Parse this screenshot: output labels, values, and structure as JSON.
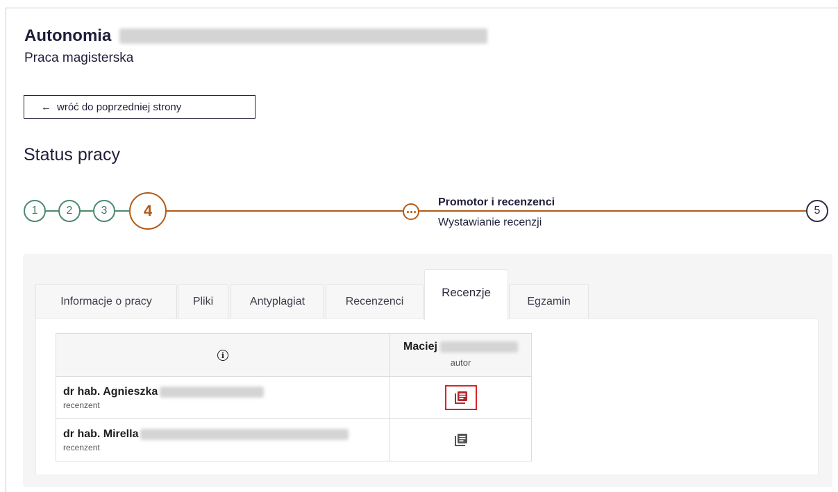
{
  "header": {
    "title": "Autonomia",
    "subtitle": "Praca magisterska",
    "back_button_label": "wróć do poprzedniej strony"
  },
  "status": {
    "heading": "Status pracy",
    "steps": [
      "1",
      "2",
      "3",
      "4",
      "5"
    ],
    "current_step": "4",
    "substep_title": "Promotor i recenzenci",
    "substep_description": "Wystawianie recenzji"
  },
  "tabs": [
    {
      "label": "Informacje o pracy",
      "active": false
    },
    {
      "label": "Pliki",
      "active": false
    },
    {
      "label": "Antyplagiat",
      "active": false
    },
    {
      "label": "Recenzenci",
      "active": false
    },
    {
      "label": "Recenzje",
      "active": true
    },
    {
      "label": "Egzamin",
      "active": false
    }
  ],
  "reviews_table": {
    "author": {
      "first_name": "Maciej",
      "role": "autor"
    },
    "reviewers": [
      {
        "name": "dr hab. Agnieszka",
        "role": "recenzent"
      },
      {
        "name": "dr hab. Mirella",
        "role": "recenzent"
      }
    ]
  },
  "colors": {
    "done": "#4a8a6e",
    "current": "#b35a16",
    "future": "#2d2d48",
    "highlight": "#d8232a",
    "review_icon_active": "#b3262d",
    "review_icon_inactive": "#555555"
  },
  "icons": {
    "info": "info-icon",
    "review_document": "document-list-icon",
    "back": "arrow-left-icon",
    "substep": "more-horizontal-icon"
  }
}
